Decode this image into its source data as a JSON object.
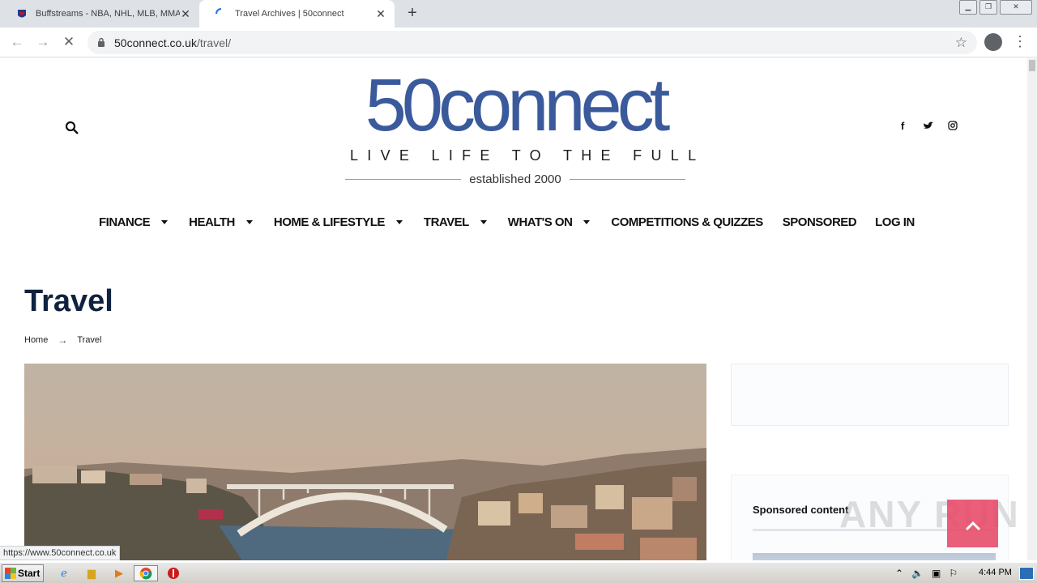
{
  "browser": {
    "tabs": [
      {
        "title": "Buffstreams - NBA, NHL, MLB, MMA,",
        "close": "✕",
        "active": false
      },
      {
        "title": "Travel Archives | 50connect",
        "close": "✕",
        "active": true
      }
    ],
    "new_tab": "+",
    "url_host": "50connect.co.uk",
    "url_path": "/travel/",
    "status_link": "https://www.50connect.co.uk"
  },
  "site": {
    "logo_main": "50connect",
    "logo_tagline": "LIVE LIFE TO THE FULL",
    "logo_established": "established 2000",
    "nav": [
      {
        "label": "FINANCE",
        "has_caret": true
      },
      {
        "label": "HEALTH",
        "has_caret": true
      },
      {
        "label": "HOME & LIFESTYLE",
        "has_caret": true
      },
      {
        "label": "TRAVEL",
        "has_caret": true
      },
      {
        "label": "WHAT'S ON",
        "has_caret": true
      },
      {
        "label": "COMPETITIONS & QUIZZES",
        "has_caret": false
      },
      {
        "label": "SPONSORED",
        "has_caret": false
      },
      {
        "label": "LOG IN",
        "has_caret": false
      }
    ],
    "social": [
      "facebook-icon",
      "twitter-icon",
      "instagram-icon"
    ]
  },
  "main": {
    "page_title": "Travel",
    "breadcrumb": {
      "home": "Home",
      "separator": "→",
      "current": "Travel"
    }
  },
  "sidebar": {
    "sponsored_title": "Sponsored content"
  },
  "watermark": "ANY RUN",
  "taskbar": {
    "start_label": "Start",
    "clock": "4:44 PM"
  },
  "colors": {
    "brand_blue": "#3a5a9c",
    "title_navy": "#102240",
    "accent_pink": "#e84d6a"
  }
}
